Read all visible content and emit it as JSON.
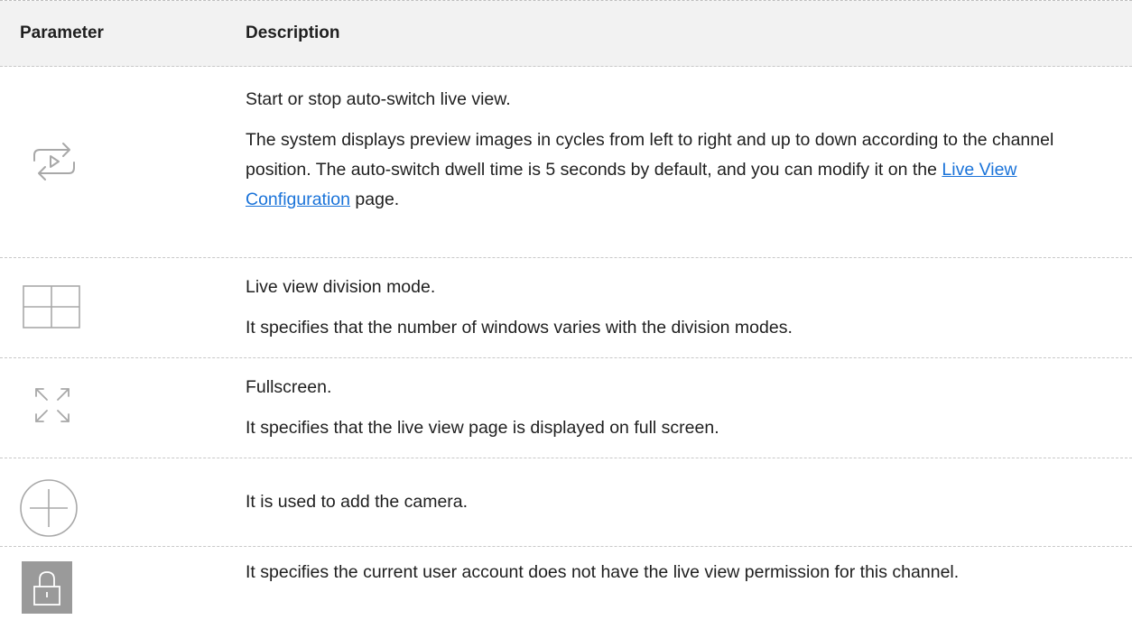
{
  "header": {
    "parameter": "Parameter",
    "description": "Description"
  },
  "rows": [
    {
      "icon": "auto-switch-play-icon",
      "line1": "Start or stop auto-switch live view.",
      "line2_before": "The system displays preview images in cycles from left to right and up to down according to the channel position. The auto-switch dwell time is 5 seconds by default, and you can modify it on the ",
      "link": "Live View Configuration",
      "line2_after": " page."
    },
    {
      "icon": "division-grid-icon",
      "line1": "Live view division mode.",
      "line2": "It specifies that the number of windows varies with the division modes."
    },
    {
      "icon": "fullscreen-icon",
      "line1": "Fullscreen.",
      "line2": "It specifies that the live view page is displayed on full screen."
    },
    {
      "icon": "add-circle-icon",
      "line1": "It is used to add the camera."
    },
    {
      "icon": "lock-icon",
      "line1": "It specifies the current user account does not have the live view permission for this channel."
    }
  ],
  "colors": {
    "header_bg": "#f2f2f2",
    "icon_gray": "#a8a8a8",
    "lock_bg": "#9a9a9a",
    "link": "#1a73d9"
  }
}
